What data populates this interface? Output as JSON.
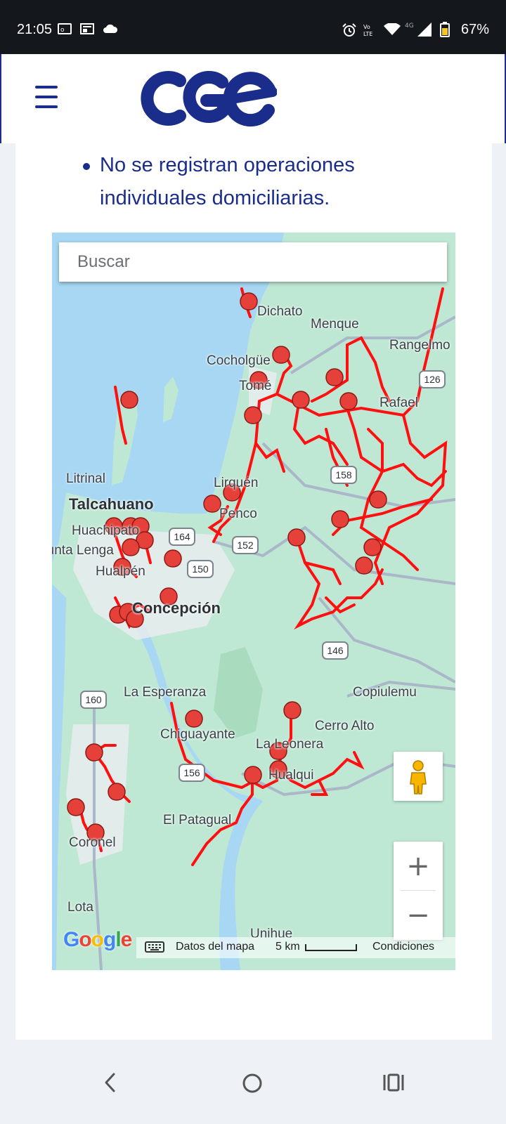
{
  "status_bar": {
    "time": "21:05",
    "battery_percent": "67%",
    "icons": [
      "outlook-icon",
      "news-icon",
      "cloud-icon",
      "alarm-icon",
      "volte-icon",
      "wifi-icon",
      "4g-signal-icon",
      "battery-icon"
    ]
  },
  "header": {
    "logo_text": "cge",
    "menu_icon": "hamburger-menu-icon",
    "brand_color": "#1a2d8a"
  },
  "notice": {
    "text": "No se registran operaciones individuales domiciliarias."
  },
  "map": {
    "search": {
      "placeholder": "Buscar",
      "value": ""
    },
    "labels": {
      "dichato": "Dichato",
      "menque": "Menque",
      "rangelmo": "Rangelmo",
      "cocholgue": "Cocholgüe",
      "tome": "Tomé",
      "rafael": "Rafael",
      "litrinal": "Litrinal",
      "talcahuano": "Talcahuano",
      "lirquen": "Lirquén",
      "penco": "Penco",
      "huachipato": "Huachipato",
      "punta_lenga": "Punta Lenga",
      "hualpen": "Hualpén",
      "concepcion": "Concepción",
      "la_esperanza": "La Esperanza",
      "copiulemu": "Copiulemu",
      "cerro_alto": "Cerro Alto",
      "chiguayante": "Chiguayante",
      "la_leonera": "La Leonera",
      "hualqui": "Hualqui",
      "el_patagual": "El Patagual",
      "coronel": "Coronel",
      "lota": "Lota",
      "unihue": "Unihue"
    },
    "routes": [
      "126",
      "158",
      "164",
      "152",
      "150",
      "146",
      "160",
      "156"
    ],
    "attribution": {
      "google": "Google",
      "map_data": "Datos del mapa",
      "scale": "5 km",
      "terms": "Condiciones"
    },
    "zoom": {
      "in": "+",
      "out": "−"
    },
    "pegman_icon": "pegman-icon",
    "network_color": "#ff1010",
    "marker_color": "#e5403a"
  },
  "nav": {
    "back_icon": "back-icon",
    "home_icon": "home-icon",
    "recents_icon": "recents-icon"
  }
}
